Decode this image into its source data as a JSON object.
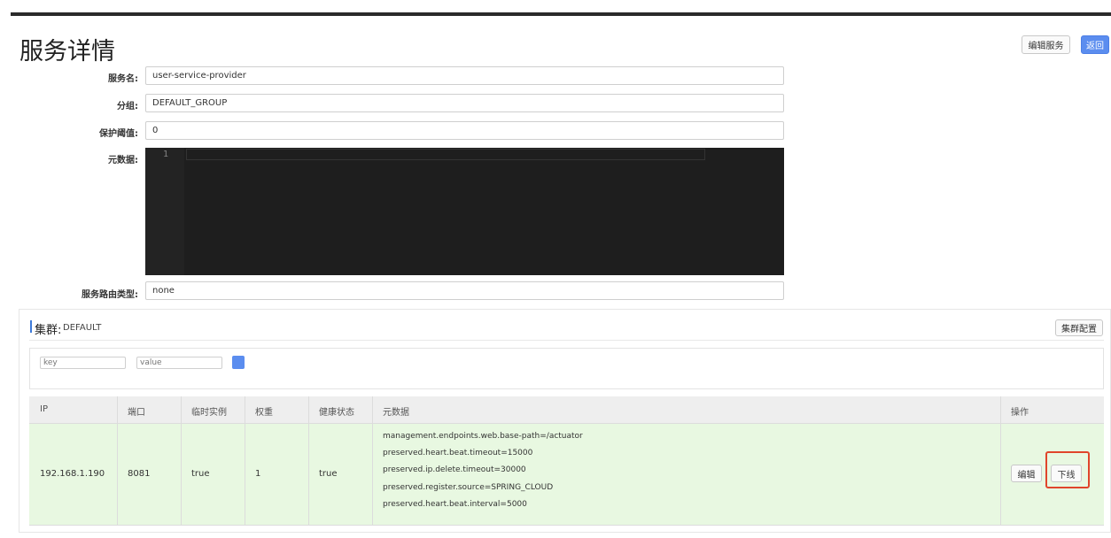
{
  "page": {
    "title": "服务详情"
  },
  "header_buttons": {
    "edit_service": "编辑服务",
    "back": "返回"
  },
  "form": {
    "service_name_label": "服务名:",
    "service_name_value": "user-service-provider",
    "group_label": "分组:",
    "group_value": "DEFAULT_GROUP",
    "protect_threshold_label": "保护阈值:",
    "protect_threshold_value": "0",
    "metadata_label": "元数据:",
    "metadata_line_number": "1",
    "route_type_label": "服务路由类型:",
    "route_type_value": "none"
  },
  "cluster": {
    "title_prefix": "集群:",
    "name": "DEFAULT",
    "config_button": "集群配置",
    "filter": {
      "key_placeholder": "key",
      "value_placeholder": "value"
    },
    "table": {
      "columns": [
        "IP",
        "端口",
        "临时实例",
        "权重",
        "健康状态",
        "元数据",
        "操作"
      ],
      "rows": [
        {
          "ip": "192.168.1.190",
          "port": "8081",
          "ephemeral": "true",
          "weight": "1",
          "healthy": "true",
          "metadata": [
            "management.endpoints.web.base-path=/actuator",
            "preserved.heart.beat.timeout=15000",
            "preserved.ip.delete.timeout=30000",
            "preserved.register.source=SPRING_CLOUD",
            "preserved.heart.beat.interval=5000"
          ],
          "actions": {
            "edit": "编辑",
            "offline": "下线"
          }
        }
      ]
    }
  },
  "colors": {
    "primary": "#5b8def",
    "row_healthy_bg": "#e8f8e1",
    "editor_bg": "#1e1e1e",
    "highlight_border": "#e0452b",
    "cluster_accent": "#3e7bd9"
  }
}
